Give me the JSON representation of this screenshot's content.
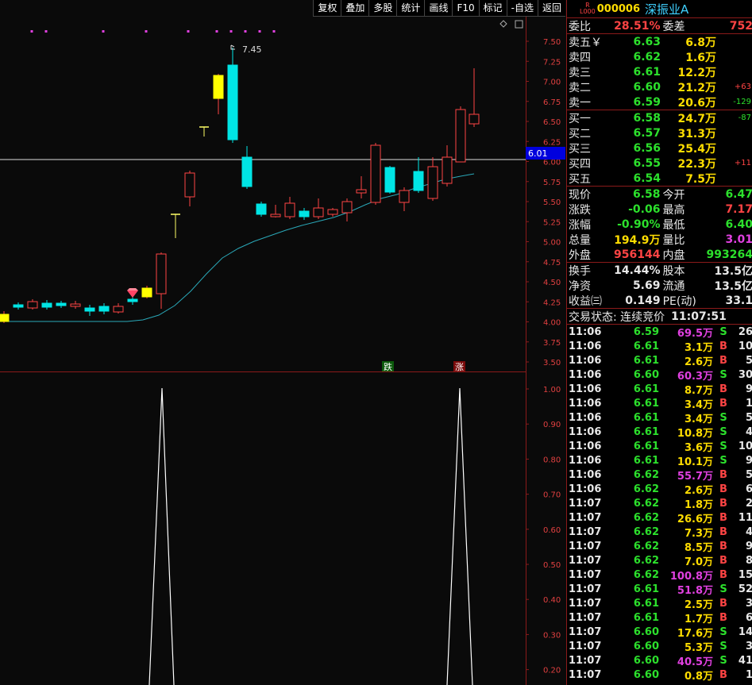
{
  "toolbar": {
    "items": [
      "复权",
      "叠加",
      "多股",
      "统计",
      "画线",
      "F10",
      "标记",
      "-自选",
      "返回"
    ]
  },
  "chart": {
    "price_axis": [
      "7.50",
      "7.25",
      "7.00",
      "6.75",
      "6.50",
      "6.25",
      "6.00",
      "5.75",
      "5.50",
      "5.25",
      "5.00",
      "4.75",
      "4.50",
      "4.25",
      "4.00",
      "3.75",
      "3.50"
    ],
    "current_price_label": "6.01",
    "high_label": "7.45",
    "indicator_axis": [
      "1.00",
      "0.90",
      "0.80",
      "0.70",
      "0.60",
      "0.50",
      "0.40",
      "0.30",
      "0.20"
    ],
    "markers": {
      "fall": "跌",
      "rise": "涨"
    },
    "colors": {
      "up": "#ff4444",
      "down": "#00e5e5",
      "flat": "#ffff00",
      "ma": "#2aa8b8",
      "bg": "#0a0a0a",
      "grid": "#8b1a1a"
    }
  },
  "quote": {
    "tag_top": "R",
    "tag_bottom": "L000",
    "code": "000006",
    "name": "深振业A",
    "weibi_label": "委比",
    "weibi_value": "28.51%",
    "weicha_label": "委差",
    "weicha_value": "752",
    "sell_orders": [
      {
        "label": "卖五￥",
        "price": "6.63",
        "vol": "6.8万",
        "chg": ""
      },
      {
        "label": "卖四",
        "price": "6.62",
        "vol": "1.6万",
        "chg": ""
      },
      {
        "label": "卖三",
        "price": "6.61",
        "vol": "12.2万",
        "chg": ""
      },
      {
        "label": "卖二",
        "price": "6.60",
        "vol": "21.2万",
        "chg": "+63"
      },
      {
        "label": "卖一",
        "price": "6.59",
        "vol": "20.6万",
        "chg": "-129"
      }
    ],
    "buy_orders": [
      {
        "label": "买一",
        "price": "6.58",
        "vol": "24.7万",
        "chg": "-87"
      },
      {
        "label": "买二",
        "price": "6.57",
        "vol": "31.3万",
        "chg": ""
      },
      {
        "label": "买三",
        "price": "6.56",
        "vol": "25.4万",
        "chg": ""
      },
      {
        "label": "买四",
        "price": "6.55",
        "vol": "22.3万",
        "chg": "+11"
      },
      {
        "label": "买五",
        "price": "6.54",
        "vol": "7.5万",
        "chg": ""
      }
    ],
    "stats": [
      {
        "l1": "现价",
        "v1": "6.58",
        "c1": "g",
        "l2": "今开",
        "v2": "6.47",
        "c2": "g"
      },
      {
        "l1": "涨跌",
        "v1": "-0.06",
        "c1": "g",
        "l2": "最高",
        "v2": "7.17",
        "c2": "r"
      },
      {
        "l1": "涨幅",
        "v1": "-0.90%",
        "c1": "g",
        "l2": "最低",
        "v2": "6.40",
        "c2": "g"
      },
      {
        "l1": "总量",
        "v1": "194.9万",
        "c1": "y",
        "l2": "量比",
        "v2": "3.01",
        "c2": "m"
      },
      {
        "l1": "外盘",
        "v1": "956144",
        "c1": "r",
        "l2": "内盘",
        "v2": "993264",
        "c2": "g"
      },
      {
        "l1": "换手",
        "v1": "14.44%",
        "c1": "w",
        "l2": "股本",
        "v2": "13.5亿",
        "c2": "w"
      },
      {
        "l1": "净资",
        "v1": "5.69",
        "c1": "w",
        "l2": "流通",
        "v2": "13.5亿",
        "c2": "w"
      },
      {
        "l1": "收益㈢",
        "v1": "0.149",
        "c1": "w",
        "l2": "PE(动)",
        "v2": "33.1",
        "c2": "w"
      }
    ],
    "status_label": "交易状态: 连续竞价",
    "status_time": "11:07:51",
    "ticks": [
      {
        "t": "11:06",
        "p": "6.59",
        "v": "69.5万",
        "vc": "m",
        "d": "S",
        "n": "26"
      },
      {
        "t": "11:06",
        "p": "6.61",
        "v": "3.1万",
        "vc": "y",
        "d": "B",
        "n": "10"
      },
      {
        "t": "11:06",
        "p": "6.61",
        "v": "2.6万",
        "vc": "y",
        "d": "B",
        "n": "5"
      },
      {
        "t": "11:06",
        "p": "6.60",
        "v": "60.3万",
        "vc": "m",
        "d": "S",
        "n": "30"
      },
      {
        "t": "11:06",
        "p": "6.61",
        "v": "8.7万",
        "vc": "y",
        "d": "B",
        "n": "9"
      },
      {
        "t": "11:06",
        "p": "6.61",
        "v": "3.4万",
        "vc": "y",
        "d": "B",
        "n": "1"
      },
      {
        "t": "11:06",
        "p": "6.61",
        "v": "3.4万",
        "vc": "y",
        "d": "S",
        "n": "5"
      },
      {
        "t": "11:06",
        "p": "6.61",
        "v": "10.8万",
        "vc": "y",
        "d": "S",
        "n": "4"
      },
      {
        "t": "11:06",
        "p": "6.61",
        "v": "3.6万",
        "vc": "y",
        "d": "S",
        "n": "10"
      },
      {
        "t": "11:06",
        "p": "6.61",
        "v": "10.1万",
        "vc": "y",
        "d": "S",
        "n": "9"
      },
      {
        "t": "11:06",
        "p": "6.62",
        "v": "55.7万",
        "vc": "m",
        "d": "B",
        "n": "5"
      },
      {
        "t": "11:06",
        "p": "6.62",
        "v": "2.6万",
        "vc": "y",
        "d": "B",
        "n": "6"
      },
      {
        "t": "11:07",
        "p": "6.62",
        "v": "1.8万",
        "vc": "y",
        "d": "B",
        "n": "2"
      },
      {
        "t": "11:07",
        "p": "6.62",
        "v": "26.6万",
        "vc": "y",
        "d": "B",
        "n": "11"
      },
      {
        "t": "11:07",
        "p": "6.62",
        "v": "7.3万",
        "vc": "y",
        "d": "B",
        "n": "4"
      },
      {
        "t": "11:07",
        "p": "6.62",
        "v": "8.5万",
        "vc": "y",
        "d": "B",
        "n": "9"
      },
      {
        "t": "11:07",
        "p": "6.62",
        "v": "7.0万",
        "vc": "y",
        "d": "B",
        "n": "8"
      },
      {
        "t": "11:07",
        "p": "6.62",
        "v": "100.8万",
        "vc": "m",
        "d": "B",
        "n": "15"
      },
      {
        "t": "11:07",
        "p": "6.61",
        "v": "51.8万",
        "vc": "m",
        "d": "S",
        "n": "52"
      },
      {
        "t": "11:07",
        "p": "6.61",
        "v": "2.5万",
        "vc": "y",
        "d": "B",
        "n": "3"
      },
      {
        "t": "11:07",
        "p": "6.61",
        "v": "1.7万",
        "vc": "y",
        "d": "B",
        "n": "6"
      },
      {
        "t": "11:07",
        "p": "6.60",
        "v": "17.6万",
        "vc": "y",
        "d": "S",
        "n": "14"
      },
      {
        "t": "11:07",
        "p": "6.60",
        "v": "5.3万",
        "vc": "y",
        "d": "S",
        "n": "3"
      },
      {
        "t": "11:07",
        "p": "6.60",
        "v": "40.5万",
        "vc": "m",
        "d": "S",
        "n": "41"
      },
      {
        "t": "11:07",
        "p": "6.60",
        "v": "0.8万",
        "vc": "y",
        "d": "B",
        "n": "1"
      }
    ]
  }
}
